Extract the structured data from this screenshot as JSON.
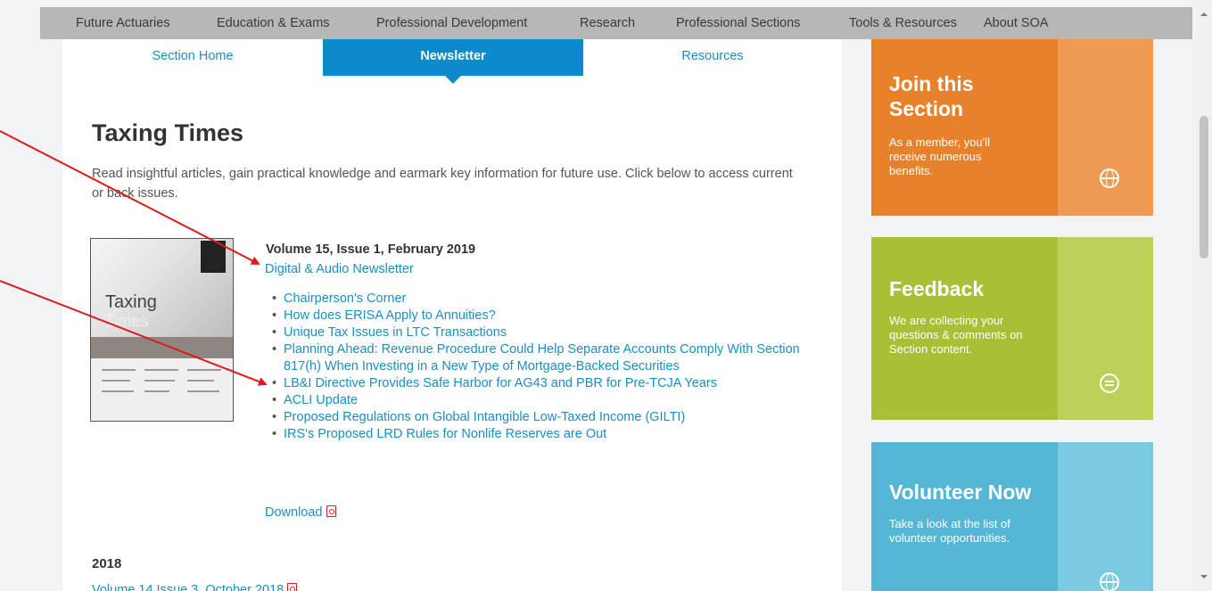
{
  "top_nav": {
    "items": [
      "Future Actuaries",
      "Education & Exams",
      "Professional Development",
      "Research",
      "Professional Sections",
      "Tools & Resources",
      "About SOA"
    ]
  },
  "section_tabs": {
    "items": [
      "Section Home",
      "Newsletter",
      "Resources"
    ],
    "active": "Newsletter"
  },
  "page": {
    "title": "Taxing Times",
    "intro": "Read insightful articles, gain practical knowledge and earmark key information for future use. Click below to access current or back issues."
  },
  "cover": {
    "title_line1": "Taxing",
    "title_line2": "Times"
  },
  "issue": {
    "title": "Volume 15, Issue 1, February 2019",
    "digital_link": "Digital & Audio Newsletter",
    "articles": [
      "Chairperson's Corner",
      "How does ERISA Apply to Annuities?",
      "Unique Tax Issues in LTC Transactions",
      "Planning Ahead: Revenue Procedure Could Help Separate Accounts Comply With Section 817(h) When Investing in a New Type of Mortgage-Backed Securities",
      "LB&I Directive Provides Safe Harbor for AG43 and PBR for Pre-TCJA Years",
      "ACLI Update",
      "Proposed Regulations on Global Intangible Low-Taxed Income (GILTI)",
      "IRS's Proposed LRD Rules for Nonlife Reserves are Out"
    ],
    "download_label": "Download"
  },
  "archive": {
    "year": "2018",
    "next_item": "Volume 14 Issue 3, October 2018"
  },
  "sidebar": {
    "join": {
      "title": "Join this Section",
      "text": "As a member, you'll receive numerous benefits.",
      "icon": "globe-icon",
      "color": "#e8822a"
    },
    "feedback": {
      "title": "Feedback",
      "text": "We are collecting your questions & comments on Section content.",
      "icon": "chat-bubble-icon",
      "color": "#a8bf36"
    },
    "volunteer": {
      "title": "Volunteer Now",
      "text": "Take a look at the list of volunteer opportunities.",
      "icon": "globe-icon",
      "color": "#56b7d5"
    }
  },
  "annotation_color": "#e0191b",
  "link_color": "#1a8fc4"
}
